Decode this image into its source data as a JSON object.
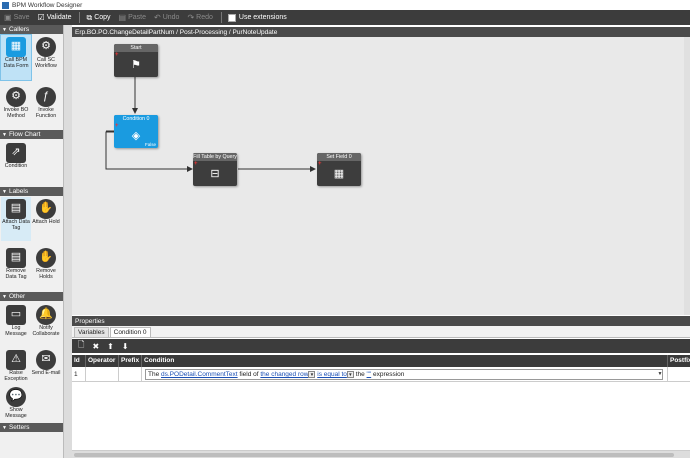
{
  "window": {
    "title": "BPM Workflow Designer"
  },
  "toolbar": {
    "save": "Save",
    "validate": "Validate",
    "copy": "Copy",
    "paste": "Paste",
    "undo": "Undo",
    "redo": "Redo",
    "use_extensions": "Use extensions"
  },
  "palette": {
    "callers": {
      "header": "Callers",
      "items": [
        {
          "label": "Call BPM Data Form",
          "icon": "data-form-icon",
          "selected": true
        },
        {
          "label": "Call SC Workflow",
          "icon": "workflow-icon"
        },
        {
          "label": "Invoke BO Method",
          "icon": "bo-method-icon"
        },
        {
          "label": "Invoke Function",
          "icon": "function-icon"
        }
      ]
    },
    "flow_chart": {
      "header": "Flow Chart",
      "items": [
        {
          "label": "Condition",
          "icon": "condition-icon"
        }
      ]
    },
    "labels": {
      "header": "Labels",
      "items": [
        {
          "label": "Attach Data Tag",
          "icon": "data-tag-icon",
          "highlighted": true
        },
        {
          "label": "Attach Hold",
          "icon": "hold-icon"
        },
        {
          "label": "Remove Data Tag",
          "icon": "remove-data-tag-icon"
        },
        {
          "label": "Remove Holds",
          "icon": "remove-hold-icon"
        }
      ]
    },
    "other": {
      "header": "Other",
      "items": [
        {
          "label": "Log Message",
          "icon": "log-icon"
        },
        {
          "label": "Notify Collaborate",
          "icon": "bell-icon"
        },
        {
          "label": "Raise Exception",
          "icon": "exception-icon"
        },
        {
          "label": "Send E-mail",
          "icon": "email-icon"
        },
        {
          "label": "Show Message",
          "icon": "message-icon"
        }
      ]
    },
    "setters": {
      "header": "Setters"
    }
  },
  "designer": {
    "breadcrumb": "Erp.BO.PO.ChangeDetailPartNum / Post-Processing / PurNoteUpdate",
    "nodes": {
      "start": {
        "label": "Start"
      },
      "condition": {
        "label": "Condition 0",
        "flag": "False"
      },
      "fill_table": {
        "label": "Fill Table by Query"
      },
      "set_field": {
        "label": "Set Field 0"
      }
    }
  },
  "properties": {
    "header": "Properties",
    "tabs": [
      "Variables",
      "Condition 0"
    ],
    "active_tab": "Condition 0",
    "columns": [
      "Id",
      "Operator",
      "Prefix",
      "Condition",
      "Postfix"
    ],
    "rows": [
      {
        "id": "1",
        "operator": "",
        "prefix": "",
        "condition": {
          "t1": "The ",
          "field": "ds.PODetail.CommentText",
          "t2": " field of ",
          "row": "the changed row",
          "op": "is equal to",
          "t3": " the ",
          "value": "\"\"",
          "t4": " expression"
        },
        "postfix": ""
      }
    ]
  }
}
